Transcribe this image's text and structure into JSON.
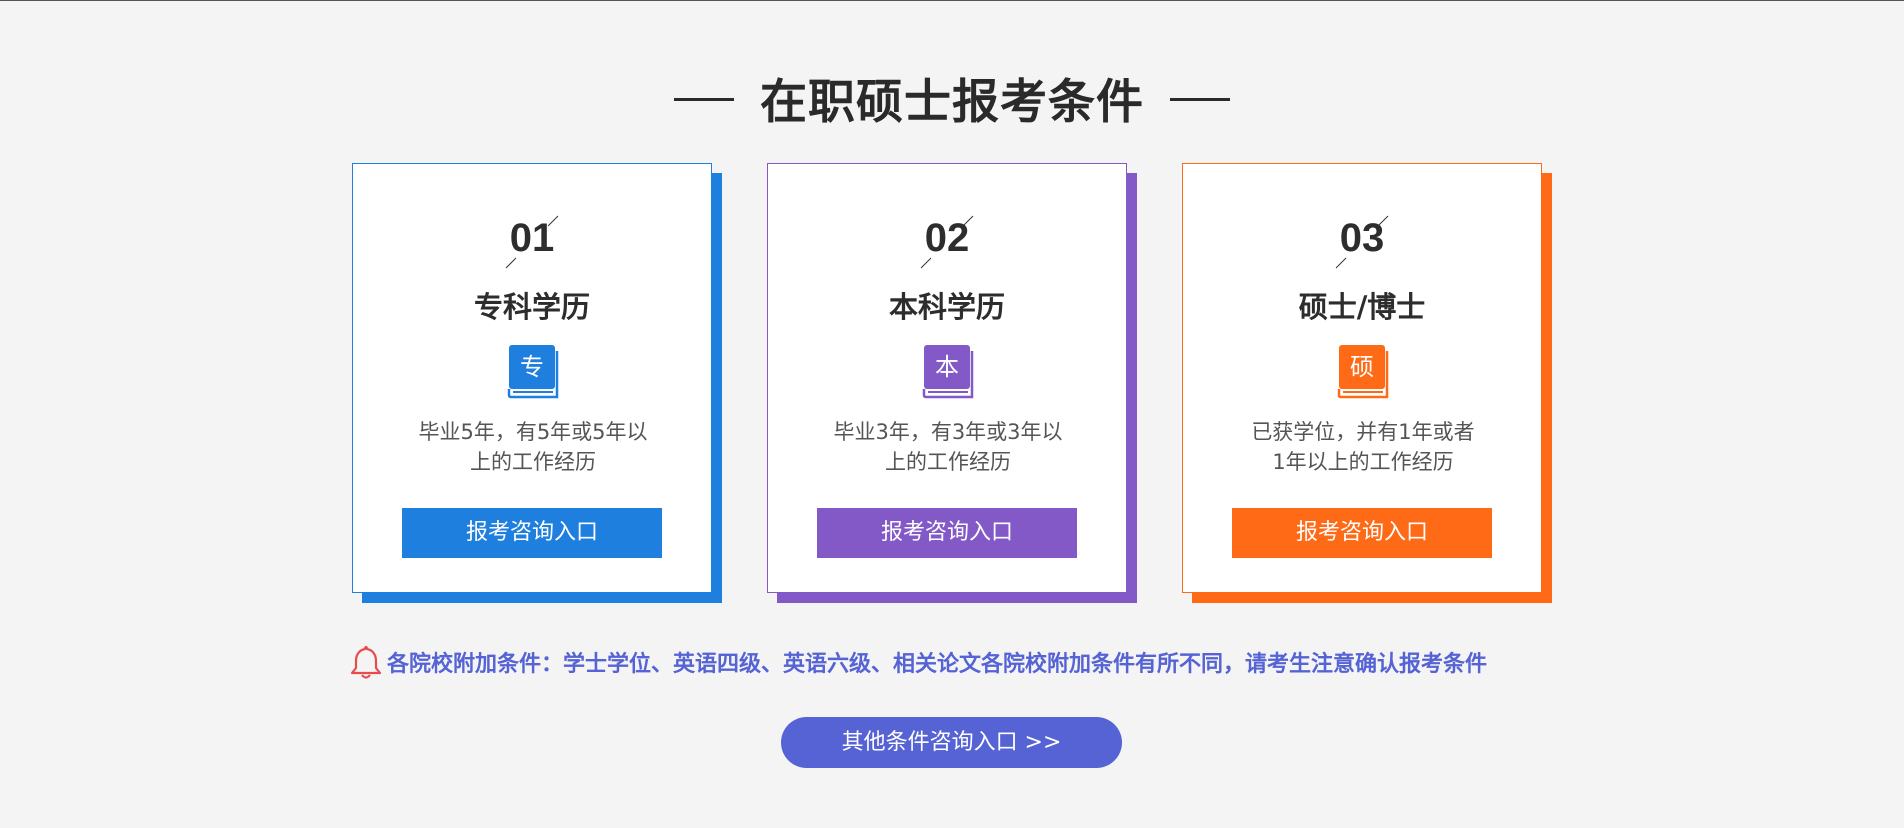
{
  "heading": {
    "title": "在职硕士报考条件"
  },
  "cards": [
    {
      "number": "01",
      "title": "专科学历",
      "icon_char": "专",
      "icon": "book-icon",
      "desc_line1": "毕业5年，有5年或5年以",
      "desc_line2": "上的工作经历",
      "button": "报考咨询入口",
      "color": "#1e7fdf"
    },
    {
      "number": "02",
      "title": "本科学历",
      "icon_char": "本",
      "icon": "book-icon",
      "desc_line1": "毕业3年，有3年或3年以",
      "desc_line2": "上的工作经历",
      "button": "报考咨询入口",
      "color": "#8359c7"
    },
    {
      "number": "03",
      "title": "硕士/博士",
      "icon_char": "硕",
      "icon": "book-icon",
      "desc_line1": "已获学位，并有1年或者",
      "desc_line2": "1年以上的工作经历",
      "button": "报考咨询入口",
      "color": "#ff6a16"
    }
  ],
  "notice": {
    "icon": "bell-icon",
    "text": "各院校附加条件：学士学位、英语四级、英语六级、相关论文各院校附加条件有所不同，请考生注意确认报考条件",
    "color": "#5563d4",
    "icon_color": "#e94b4b"
  },
  "more_button": {
    "label": "其他条件咨询入口 >>",
    "color": "#5563d4"
  }
}
